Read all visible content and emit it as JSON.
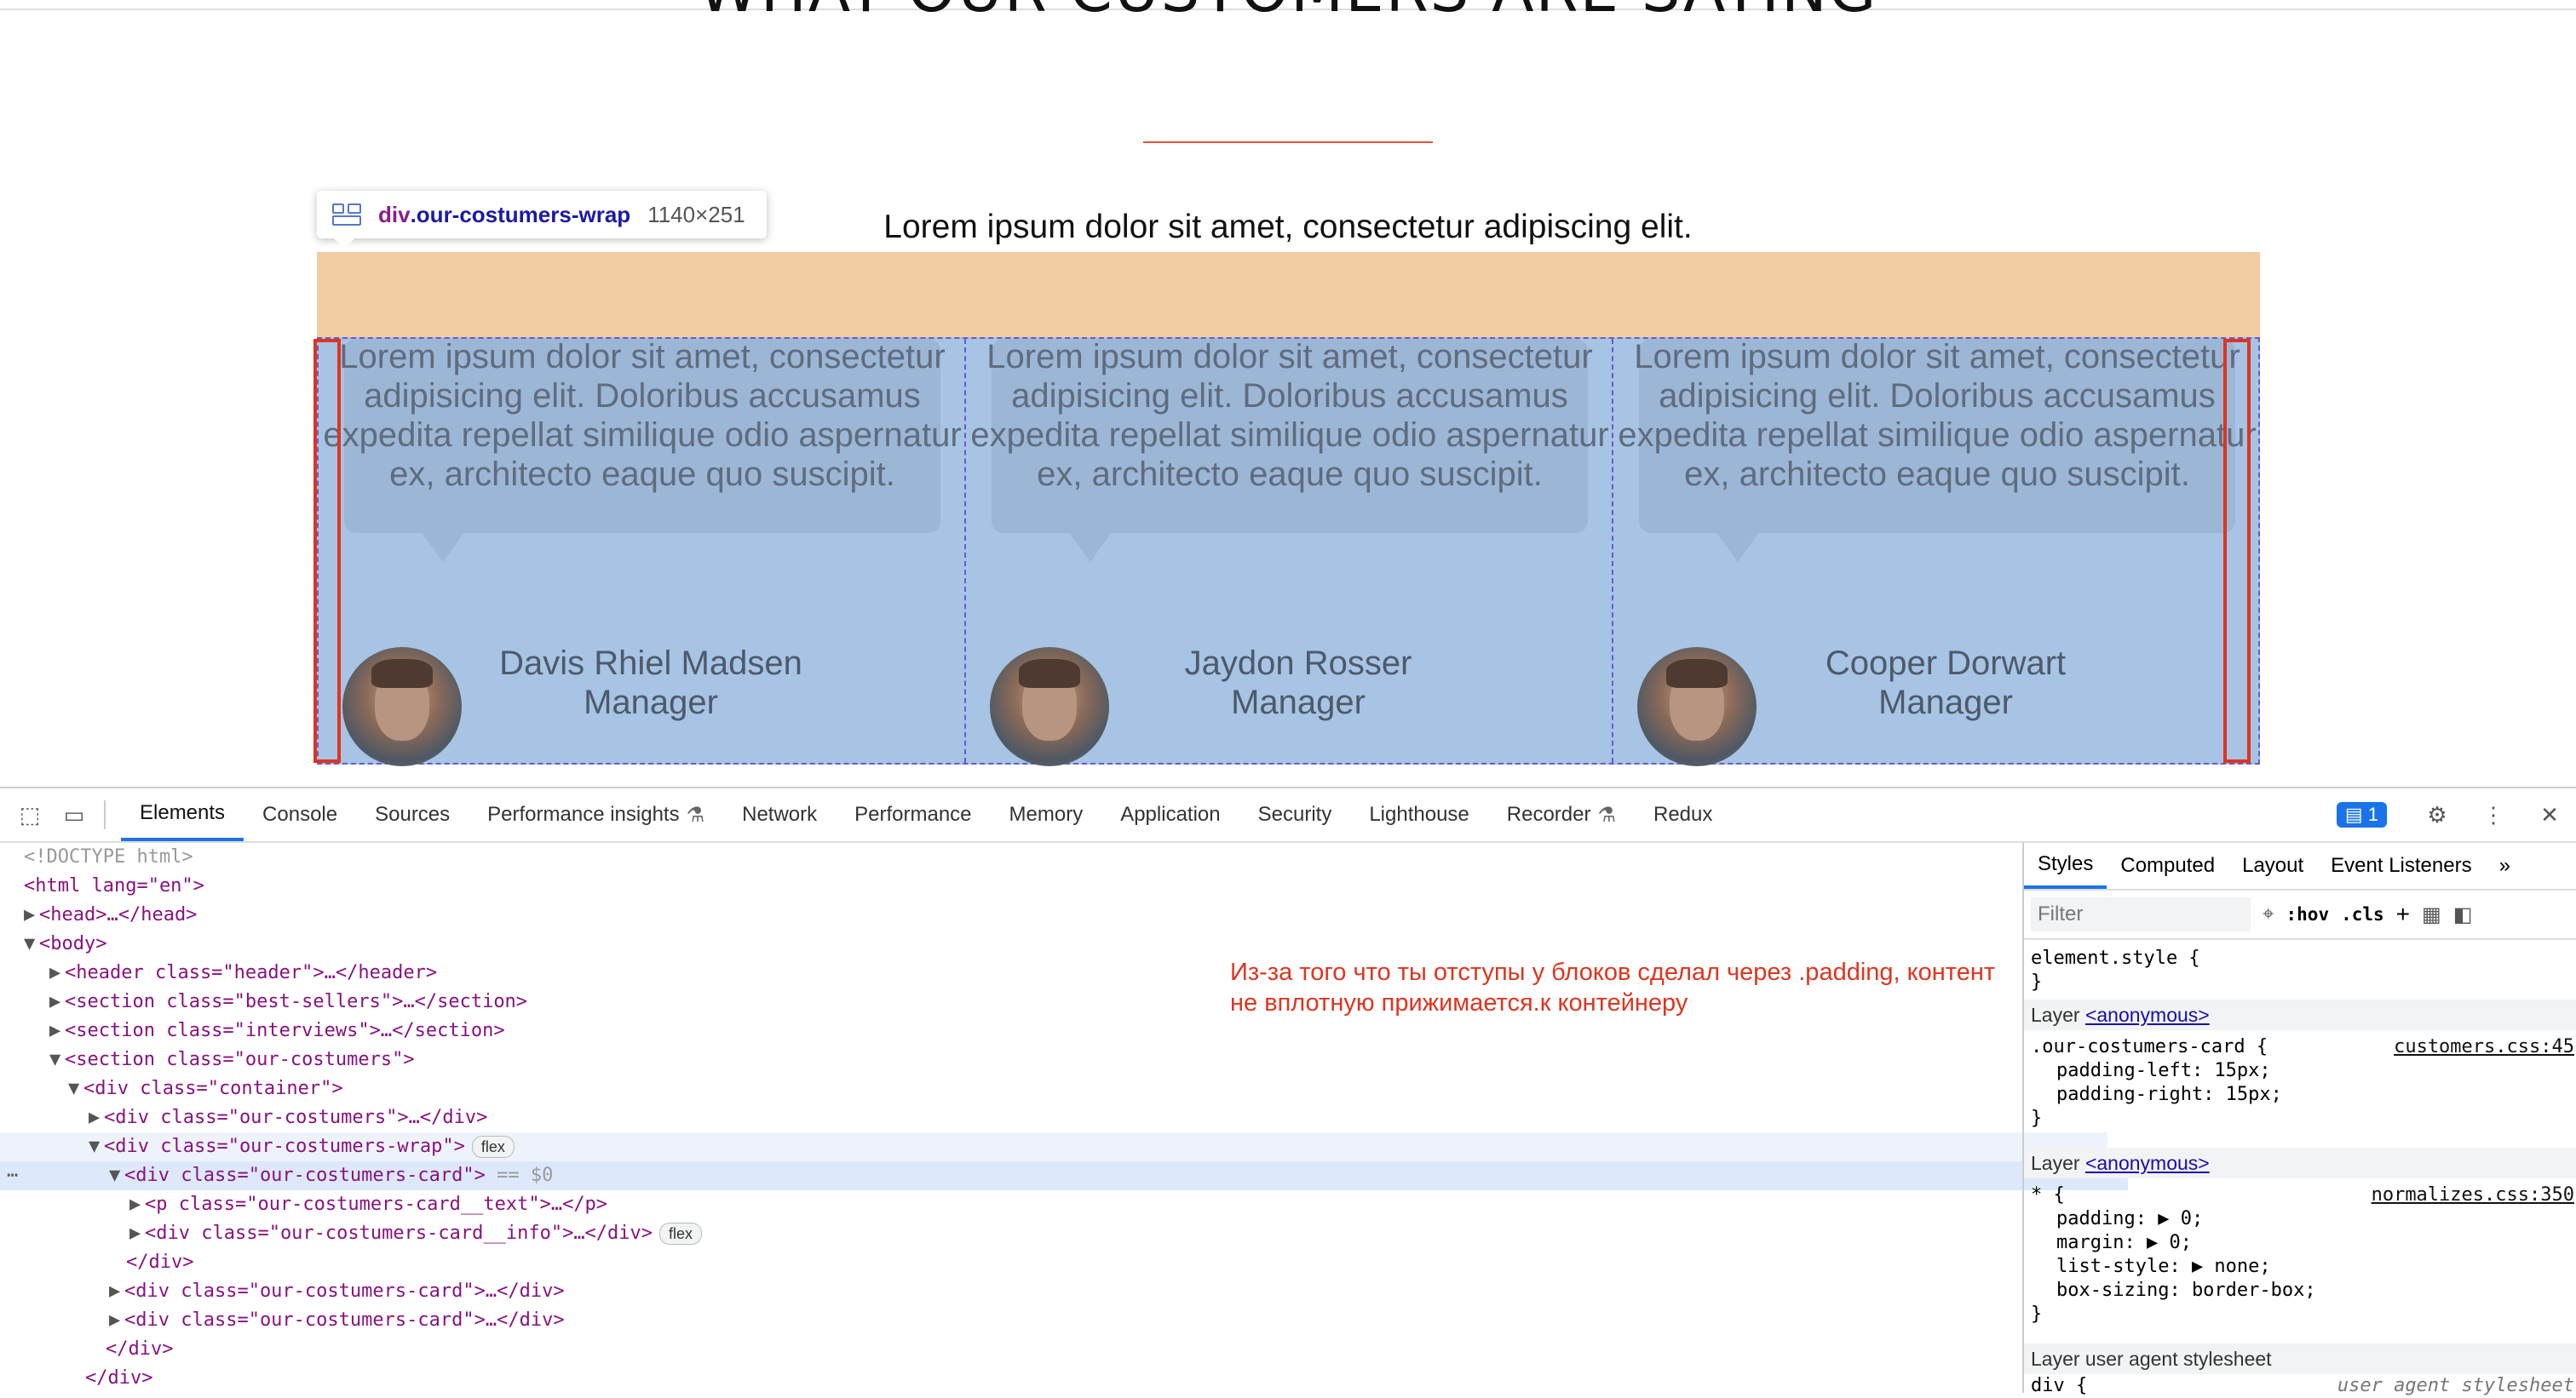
{
  "page": {
    "heading": "WHAT OUR CUSTOMERS ARE SAYING",
    "subtitle": "Lorem ipsum dolor sit amet, consectetur adipiscing elit.",
    "tooltip": {
      "tag": "div",
      "class": ".our-costumers-wrap",
      "size": "1140×251"
    },
    "cards": [
      {
        "text": "Lorem ipsum dolor sit amet, consectetur adipisicing elit. Doloribus accusamus expedita repellat similique odio aspernatur ex, architecto eaque quo suscipit.",
        "name": "Davis Rhiel Madsen",
        "role": "Manager"
      },
      {
        "text": "Lorem ipsum dolor sit amet, consectetur adipisicing elit. Doloribus accusamus expedita repellat similique odio aspernatur ex, architecto eaque quo suscipit.",
        "name": "Jaydon Rosser",
        "role": "Manager"
      },
      {
        "text": "Lorem ipsum dolor sit amet, consectetur adipisicing elit. Doloribus accusamus expedita repellat similique odio aspernatur ex, architecto eaque quo suscipit.",
        "name": "Cooper Dorwart",
        "role": "Manager"
      }
    ]
  },
  "devtools": {
    "tabs": [
      "Elements",
      "Console",
      "Sources",
      "Performance insights",
      "Network",
      "Performance",
      "Memory",
      "Application",
      "Security",
      "Lighthouse",
      "Recorder",
      "Redux"
    ],
    "issues_count": "1",
    "dom": [
      "<!DOCTYPE html>",
      "<html lang=\"en\">",
      "<head>…</head>",
      "<body>",
      "<header class=\"header\">…</header>",
      "<section class=\"best-sellers\">…</section>",
      "<section class=\"interviews\">…</section>",
      "<section class=\"our-costumers\">",
      "<div class=\"container\">",
      "<div class=\"our-costumers\">…</div>",
      "<div class=\"our-costumers-wrap\">",
      "<div class=\"our-costumers-card\">",
      "<p class=\"our-costumers-card__text\">…</p>",
      "<div class=\"our-costumers-card__info\">…</div>",
      "</div>",
      "<div class=\"our-costumers-card\">…</div>",
      "<div class=\"our-costumers-card\">…</div>",
      "</div>",
      "</div>"
    ],
    "flex_badge": "flex",
    "selected_marker": "== $0",
    "comment": "Из-за того что ты отступы у блоков сделал через .padding, контент не вплотную прижимается.к контейнеру",
    "styles": {
      "tabs": [
        "Styles",
        "Computed",
        "Layout",
        "Event Listeners"
      ],
      "filter_placeholder": "Filter",
      "hov": ":hov",
      "cls": ".cls",
      "element_style": "element.style {",
      "close": "}",
      "layer_label": "Layer",
      "anonymous": "<anonymous>",
      "rule1_selector": ".our-costumers-card {",
      "rule1_source": "customers.css:45",
      "rule1_props": [
        "padding-left: 15px;",
        "padding-right: 15px;"
      ],
      "rule2_selector": "* {",
      "rule2_source": "normalizes.css:350",
      "rule2_props": [
        "padding: ▶ 0;",
        "margin: ▶ 0;",
        "list-style: ▶ none;",
        "box-sizing: border-box;"
      ],
      "ua_layer": "Layer user agent stylesheet",
      "ua_selector": "div {",
      "ua_source": "user agent stylesheet"
    }
  }
}
